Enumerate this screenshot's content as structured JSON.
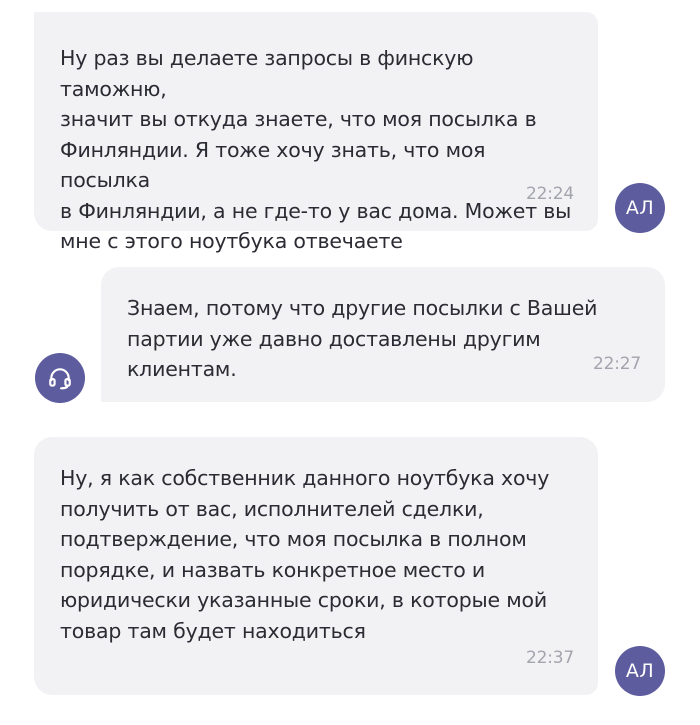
{
  "messages": [
    {
      "text": "Ну раз вы делаете запросы в финскую таможню,\nзначит вы откуда знаете, что моя посылка в\nФинляндии. Я тоже хочу знать, что моя посылка\nв Финляндии, а не где-то у вас дома. Может вы\nмне с этого ноутбука отвечаете",
      "time": "22:24",
      "sender": "user",
      "avatar": "АЛ"
    },
    {
      "text": "Знаем, потому что другие посылки с Вашей\nпартии уже давно доставлены другим клиентам.",
      "time": "22:27",
      "sender": "support",
      "avatar_icon": "headset-icon"
    },
    {
      "text": "Ну, я как собственник данного ноутбука хочу\nполучить от вас, исполнителей сделки,\nподтверждение, что моя посылка в полном\nпорядке, и назвать конкретное место и\nюридически указанные сроки, в которые мой\nтовар там будет находиться",
      "time": "22:37",
      "sender": "user",
      "avatar": "АЛ"
    }
  ],
  "colors": {
    "bubble": "#f2f2f5",
    "avatar": "#5d5c9e",
    "text": "#2b2b33",
    "time": "#a3a4ad"
  }
}
